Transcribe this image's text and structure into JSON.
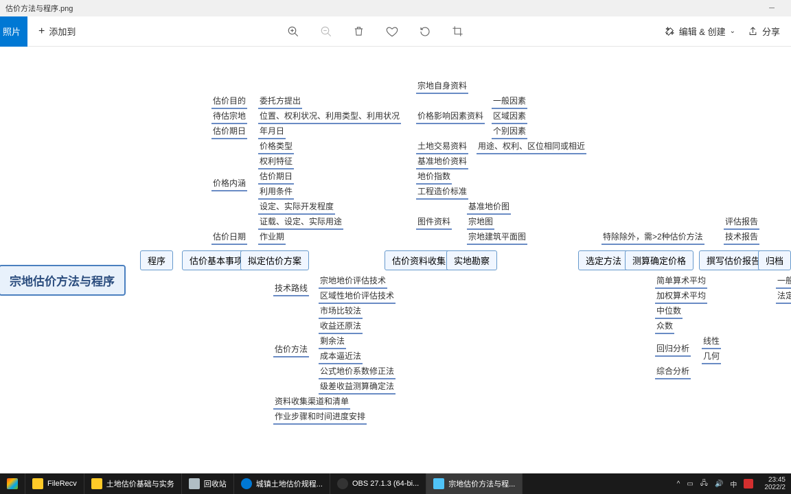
{
  "window": {
    "title": "估价方法与程序.png"
  },
  "toolbar": {
    "photo_btn": "照片",
    "add_btn": "添加到",
    "edit_create": "编辑 & 创建",
    "share": "分享"
  },
  "mindmap": {
    "root": "宗地估价方法与程序",
    "n_procedure": "程序",
    "n_basic": "估价基本事项",
    "n_plan": "拟定估价方案",
    "n_collect": "估价资料收集",
    "n_survey": "实地勘察",
    "n_method": "选定方法",
    "n_calc": "测算确定价格",
    "n_report": "撰写估价报告",
    "n_archive": "归档",
    "b1": "估价目的",
    "b1a": "委托方提出",
    "b2": "待估宗地",
    "b2a": "位置、权利状况、利用类型、利用状况",
    "b3": "估价期日",
    "b3a": "年月日",
    "b4": "价格内涵",
    "c1": "价格类型",
    "c2": "权利特征",
    "c3": "估价期日",
    "c4": "利用条件",
    "c5": "设定、实际开发程度",
    "c6": "证载、设定、实际用途",
    "b5": "估价日期",
    "b5a": "作业期",
    "p1": "技术路线",
    "p1a": "宗地地价评估技术",
    "p1b": "区域性地价评估技术",
    "p2": "估价方法",
    "p2a": "市场比较法",
    "p2b": "收益还原法",
    "p2c": "剩余法",
    "p2d": "成本逼近法",
    "p2e": "公式地价系数修正法",
    "p2f": "级差收益测算确定法",
    "p3": "资料收集渠道和清单",
    "p4": "作业步骤和时间进度安排",
    "d1": "宗地自身资料",
    "d2": "价格影响因素资料",
    "d2a": "一般因素",
    "d2b": "区域因素",
    "d2c": "个别因素",
    "d3": "土地交易资料",
    "d3a": "用途、权利、区位相同或相近",
    "d4": "基准地价资料",
    "d5": "地价指数",
    "d6": "工程造价标准",
    "d7": "图件资料",
    "d7a": "基准地价图",
    "d7b": "宗地图",
    "d7c": "宗地建筑平面图",
    "m1": "特除除外，需>2种估价方法",
    "ca1": "简单算术平均",
    "ca2": "加权算术平均",
    "ca3": "中位数",
    "ca4": "众数",
    "ca5": "回归分析",
    "ca5a": "线性",
    "ca5b": "几何",
    "ca6": "综合分析",
    "r1": "评估报告",
    "r2": "技术报告",
    "ar1": "一般",
    "ar2": "法定"
  },
  "taskbar": {
    "t1": "FileRecv",
    "t2": "土地估价基础与实务",
    "t3": "回收站",
    "t4": "城镇土地估价规程...",
    "t5": "OBS 27.1.3 (64-bi...",
    "t6": "宗地估价方法与程...",
    "ime": "中",
    "time": "23:45",
    "date": "2022/2"
  }
}
